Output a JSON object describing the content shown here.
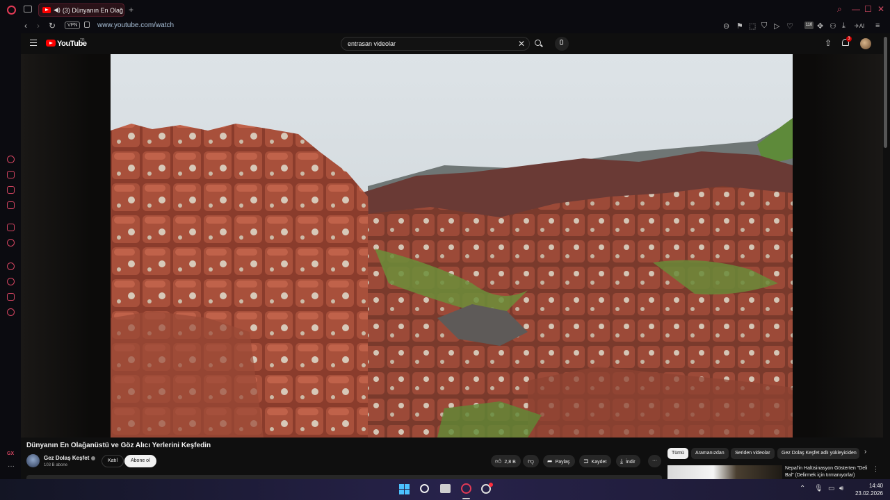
{
  "browser": {
    "tab_title": "(3) Dünyanın En Olağ",
    "url": "www.youtube.com/watch",
    "vpn_label": "VPN",
    "ext_badge": "110",
    "ai_label": "AI",
    "sidebar_gx": "GX"
  },
  "youtube": {
    "logo_text": "YouTube",
    "region": "TR",
    "search_value": "entrasan videolar",
    "notification_count": "3",
    "video_title": "Dünyanın En Olağanüstü ve Göz Alıcı Yerlerini Keşfedin",
    "channel_name": "Gez Dolaş Keşfet",
    "subscribers": "103 B abone",
    "join_label": "Katıl",
    "subscribe_label": "Abone ol",
    "like_count": "2,8 B",
    "share_label": "Paylaş",
    "save_label": "Kaydet",
    "download_label": "İndir",
    "chips": [
      "Tümü",
      "Aramanızdan",
      "Seriden videolar",
      "Gez Dolaş Keşfet adlı yükleyiciden"
    ],
    "rec_title_1": "Nepal'in Halüsinasyon Gösterten \"Deli",
    "rec_title_2": "Bal\" (Delirmek için tırmanıyorlar)"
  },
  "taskbar": {
    "time": "14:40",
    "date": "23.02.2026"
  },
  "colors": {
    "opera_red": "#e23a55",
    "youtube_red": "#ff0000",
    "youtube_bg": "#0f0f0f"
  }
}
